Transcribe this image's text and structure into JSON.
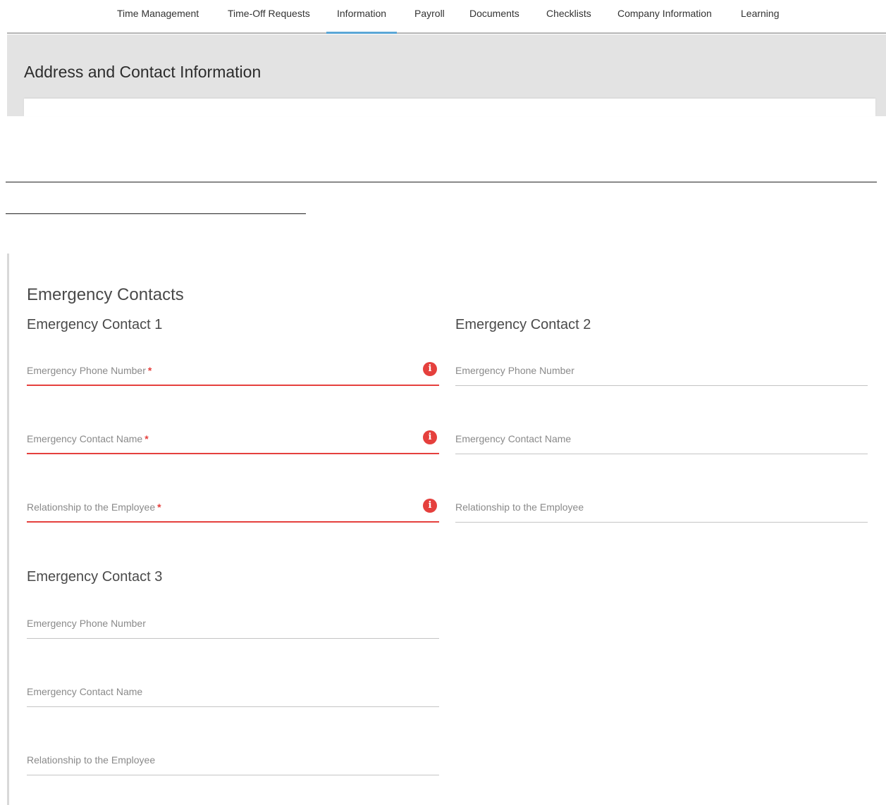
{
  "nav": {
    "tabs": [
      {
        "label": "Time Management"
      },
      {
        "label": "Time-Off Requests"
      },
      {
        "label": "Information",
        "active": true
      },
      {
        "label": "Payroll"
      },
      {
        "label": "Documents"
      },
      {
        "label": "Checklists"
      },
      {
        "label": "Company Information"
      },
      {
        "label": "Learning"
      }
    ]
  },
  "address": {
    "title": "Address and Contact Information"
  },
  "emergency": {
    "title": "Emergency Contacts",
    "required_mark": "*",
    "error_icon_glyph": "i",
    "contacts": [
      {
        "title": "Emergency Contact 1",
        "fields": [
          {
            "label": "Emergency Phone Number",
            "required": true,
            "error": true,
            "value": ""
          },
          {
            "label": "Emergency Contact Name",
            "required": true,
            "error": true,
            "value": ""
          },
          {
            "label": "Relationship to the Employee",
            "required": true,
            "error": true,
            "value": ""
          }
        ]
      },
      {
        "title": "Emergency Contact 2",
        "fields": [
          {
            "label": "Emergency Phone Number",
            "required": false,
            "error": false,
            "value": ""
          },
          {
            "label": "Emergency Contact Name",
            "required": false,
            "error": false,
            "value": ""
          },
          {
            "label": "Relationship to the Employee",
            "required": false,
            "error": false,
            "value": ""
          }
        ]
      },
      {
        "title": "Emergency Contact 3",
        "fields": [
          {
            "label": "Emergency Phone Number",
            "required": false,
            "error": false,
            "value": ""
          },
          {
            "label": "Emergency Contact Name",
            "required": false,
            "error": false,
            "value": ""
          },
          {
            "label": "Relationship to the Employee",
            "required": false,
            "error": false,
            "value": ""
          }
        ]
      }
    ]
  },
  "colors": {
    "active_tab_underline": "#5aa6d6",
    "error": "#e5403d",
    "band_background": "#e3e3e3"
  }
}
